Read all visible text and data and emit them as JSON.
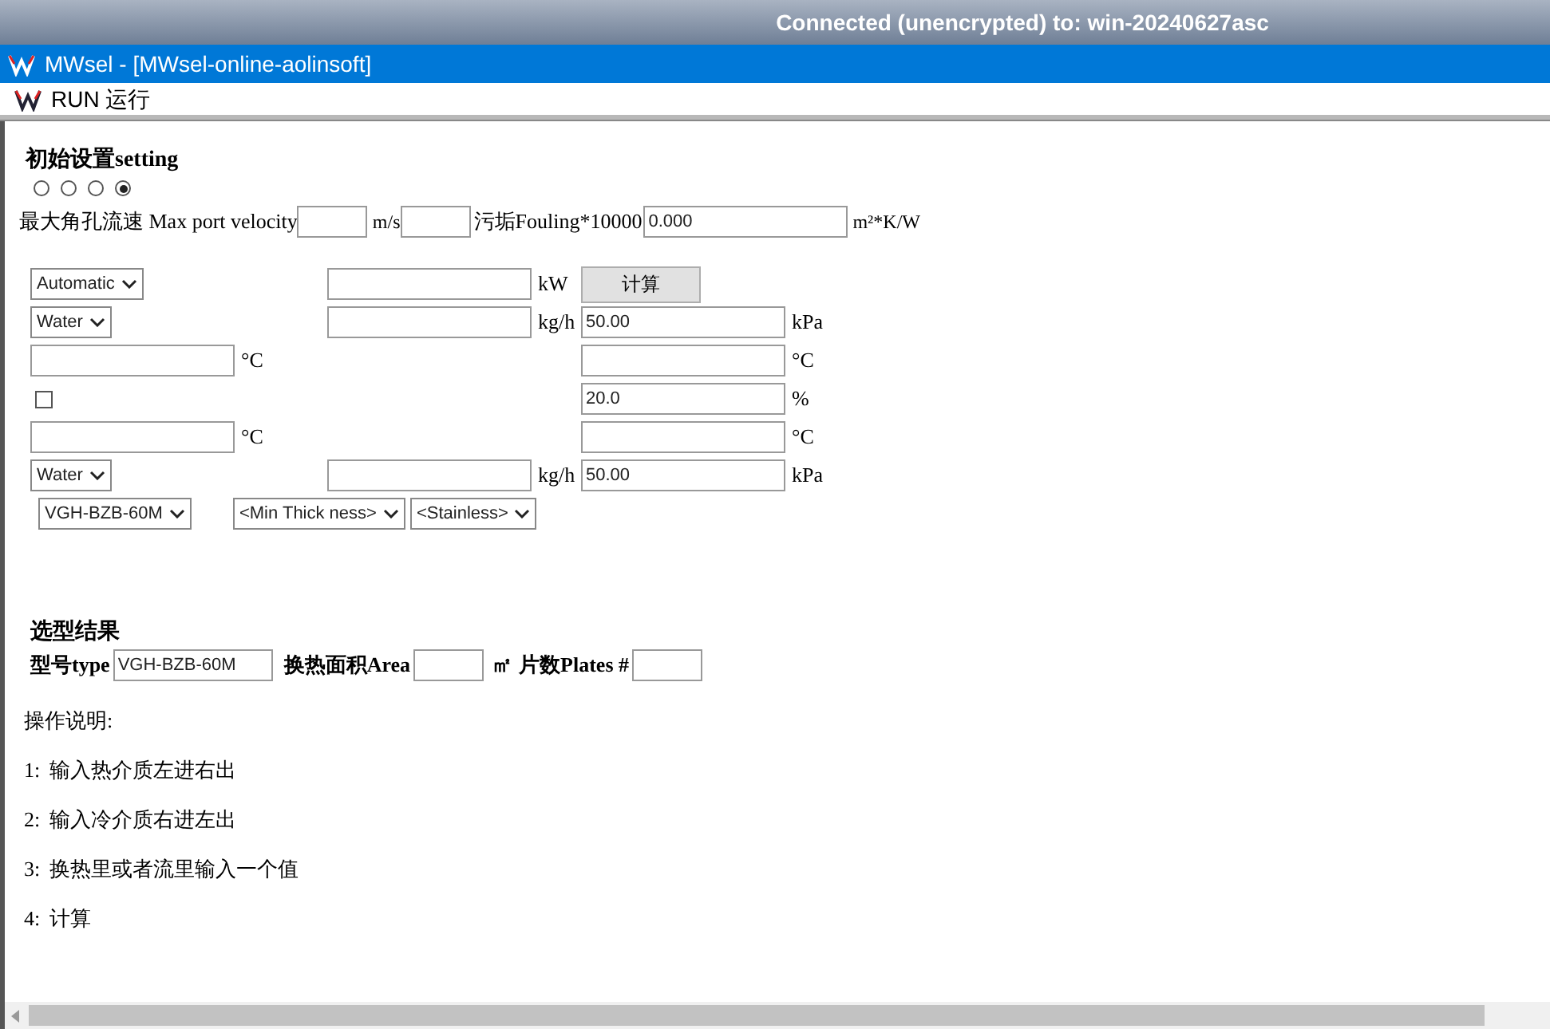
{
  "connection_bar": {
    "title": "Connected (unencrypted) to: win-20240627asc"
  },
  "window": {
    "title": "MWsel - [MWsel-online-aolinsoft]"
  },
  "menu": {
    "items": [
      "RUN 运行"
    ]
  },
  "settings": {
    "heading": "初始设置setting",
    "radios": [
      {
        "selected": false
      },
      {
        "selected": false
      },
      {
        "selected": false
      },
      {
        "selected": true
      }
    ],
    "velocity_label": "最大角孔流速  Max port velocity",
    "velocity_unit": "m/s",
    "fouling_label": "污垢Fouling*10000",
    "fouling_value": "0.000",
    "fouling_unit": "m²*K/W"
  },
  "form_rows": [
    {
      "left": {
        "kind": "select",
        "value": "Automatic"
      },
      "middle": {
        "kind": "field",
        "unit": "kW"
      },
      "right": {
        "kind": "button",
        "label": "计算"
      }
    },
    {
      "left": {
        "kind": "select",
        "value": "Water"
      },
      "middle": {
        "kind": "field",
        "unit": "kg/h"
      },
      "right": {
        "kind": "field",
        "value": "50.00",
        "unit": "kPa"
      }
    },
    {
      "left": {
        "kind": "field",
        "unit": "°C"
      },
      "right": {
        "kind": "field",
        "unit": "°C"
      }
    },
    {
      "left": {
        "kind": "checkbox",
        "checked": false
      },
      "right": {
        "kind": "field",
        "value": "20.0",
        "unit": "%"
      }
    },
    {
      "left": {
        "kind": "field",
        "unit": "°C"
      },
      "right": {
        "kind": "field",
        "unit": "°C"
      }
    },
    {
      "left": {
        "kind": "select",
        "value": "Water"
      },
      "middle": {
        "kind": "field",
        "unit": "kg/h"
      },
      "right": {
        "kind": "field",
        "value": "50.00",
        "unit": "kPa"
      }
    }
  ],
  "model_selects": [
    "VGH-BZB-60M",
    "<Min Thick ness>",
    "<Stainless>"
  ],
  "result": {
    "heading": "选型结果",
    "type_label": "型号type",
    "type_value": "VGH-BZB-60M",
    "area_label": "换热面积Area",
    "area_unit": "㎡",
    "plates_label": "片数Plates #"
  },
  "instructions": {
    "heading": "操作说明:",
    "steps": [
      {
        "number": "1:",
        "text": "输入热介质左进右出"
      },
      {
        "number": "2:",
        "text": "输入冷介质右进左出"
      },
      {
        "number": "3:",
        "text": "换热里或者流里输入一个值"
      },
      {
        "number": "4:",
        "text": "计算"
      }
    ]
  }
}
